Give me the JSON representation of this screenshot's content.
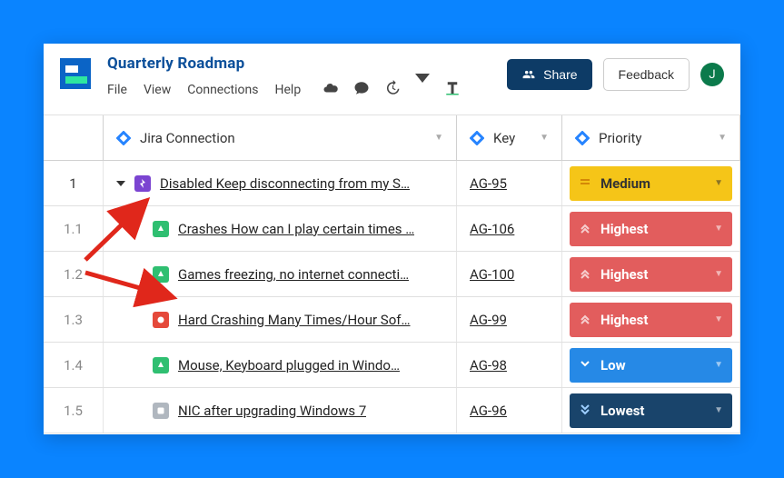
{
  "header": {
    "doc_title": "Quarterly Roadmap",
    "menu": {
      "file": "File",
      "view": "View",
      "connections": "Connections",
      "help": "Help"
    },
    "share_label": "Share",
    "feedback_label": "Feedback",
    "avatar_initial": "J"
  },
  "columns": {
    "title": "Jira Connection",
    "key": "Key",
    "priority": "Priority"
  },
  "rows": [
    {
      "num": "1",
      "type": "epic",
      "indent": false,
      "expanded": true,
      "summary": "Disabled Keep disconnecting from my S…",
      "key": "AG-95",
      "priority_label": "Medium",
      "priority_class": "p-medium"
    },
    {
      "num": "1.1",
      "type": "story",
      "indent": true,
      "expanded": false,
      "summary": "Crashes How can I play certain times …",
      "key": "AG-106",
      "priority_label": "Highest",
      "priority_class": "p-highest"
    },
    {
      "num": "1.2",
      "type": "story",
      "indent": true,
      "expanded": false,
      "summary": "Games freezing, no internet connecti…",
      "key": "AG-100",
      "priority_label": "Highest",
      "priority_class": "p-highest"
    },
    {
      "num": "1.3",
      "type": "bug",
      "indent": true,
      "expanded": false,
      "summary": "Hard Crashing Many Times/Hour Sof…",
      "key": "AG-99",
      "priority_label": "Highest",
      "priority_class": "p-highest"
    },
    {
      "num": "1.4",
      "type": "story",
      "indent": true,
      "expanded": false,
      "summary": "Mouse, Keyboard plugged in Windo…",
      "key": "AG-98",
      "priority_label": "Low",
      "priority_class": "p-low"
    },
    {
      "num": "1.5",
      "type": "task",
      "indent": true,
      "expanded": false,
      "summary": "NIC after upgrading Windows 7",
      "key": "AG-96",
      "priority_label": "Lowest",
      "priority_class": "p-lowest"
    }
  ]
}
